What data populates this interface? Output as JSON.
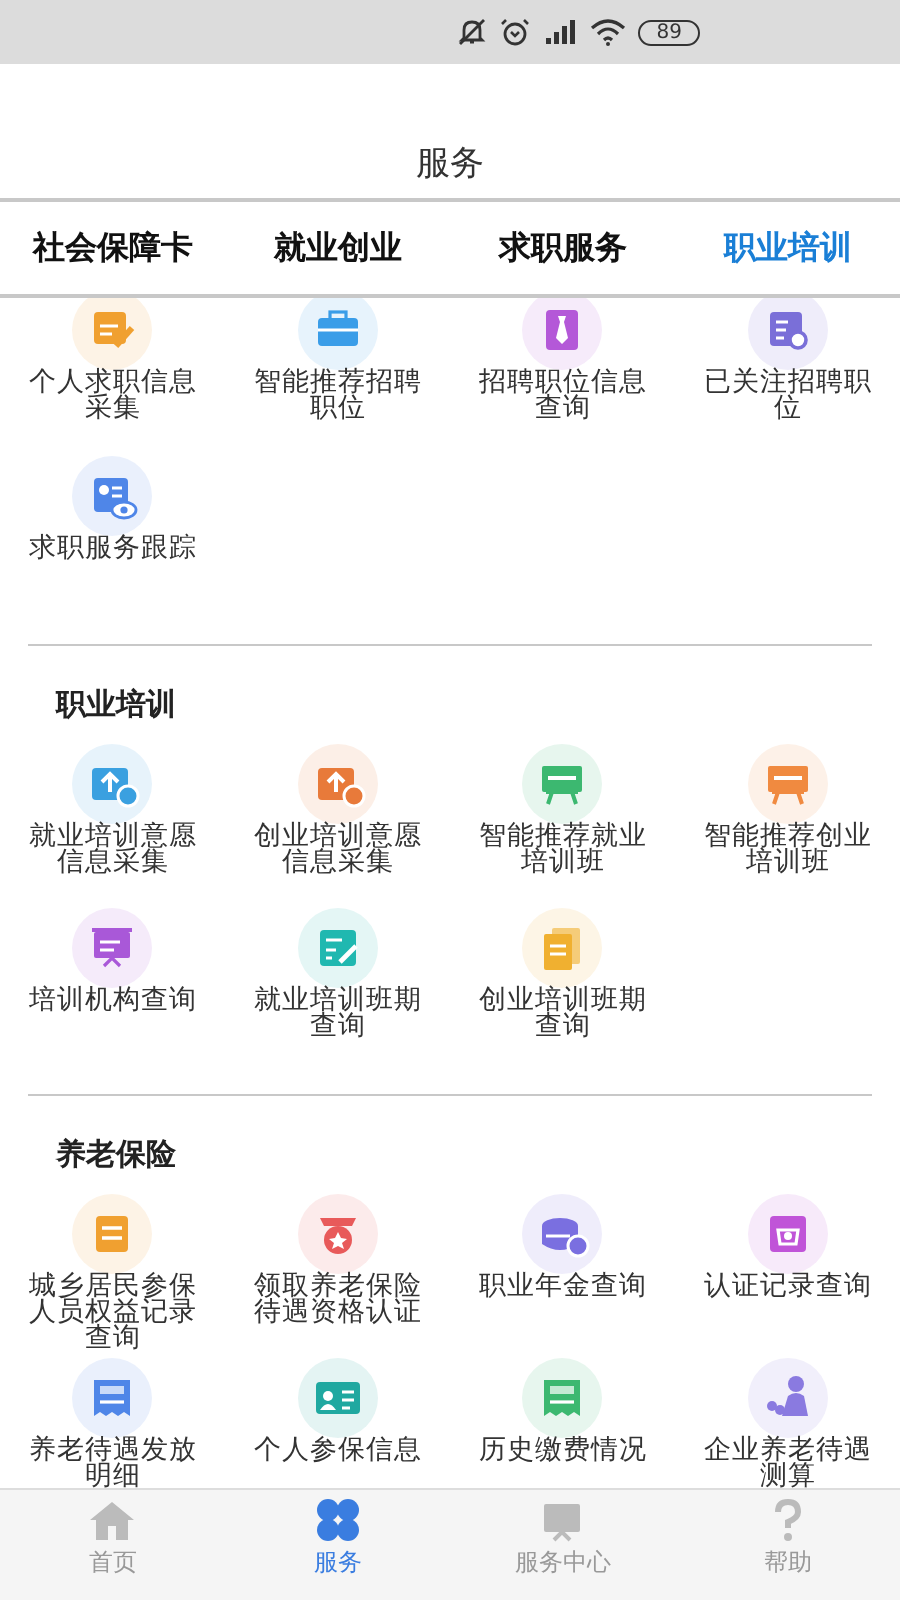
{
  "status_bar": {
    "battery": "89"
  },
  "header": {
    "title": "服务"
  },
  "tabs": [
    {
      "label": "社会保障卡",
      "selected": false
    },
    {
      "label": "就业创业",
      "selected": false
    },
    {
      "label": "求职服务",
      "selected": false
    },
    {
      "label": "职业培训",
      "selected": true
    }
  ],
  "sections": [
    {
      "items": [
        {
          "label": "个人求职信息采集",
          "kind": "docpen",
          "color": "#f0a030"
        },
        {
          "label": "智能推荐招聘职位",
          "kind": "briefcase",
          "color": "#3a9de8"
        },
        {
          "label": "招聘职位信息查询",
          "kind": "tie",
          "color": "#b458d8"
        },
        {
          "label": "已关注招聘职位",
          "kind": "search",
          "color": "#7a6fd8"
        },
        {
          "label": "求职服务跟踪",
          "kind": "eye",
          "color": "#4f86e8"
        }
      ]
    },
    {
      "title": "职业培训",
      "items": [
        {
          "label": "就业培训意愿信息采集",
          "kind": "upload",
          "color": "#3aa0e0"
        },
        {
          "label": "创业培训意愿信息采集",
          "kind": "upload",
          "color": "#e87a3a"
        },
        {
          "label": "智能推荐就业培训班",
          "kind": "easel",
          "color": "#3cb870"
        },
        {
          "label": "智能推荐创业培训班",
          "kind": "easel",
          "color": "#f08a40"
        },
        {
          "label": "培训机构查询",
          "kind": "screen",
          "color": "#a958d8"
        },
        {
          "label": "就业培训班期查询",
          "kind": "pencil",
          "color": "#20b8b0"
        },
        {
          "label": "创业培训班期查询",
          "kind": "book",
          "color": "#f0b030"
        }
      ]
    },
    {
      "title": "养老保险",
      "items": [
        {
          "label": "城乡居民参保人员权益记录查询",
          "kind": "doc",
          "color": "#f0a030"
        },
        {
          "label": "领取养老保险待遇资格认证",
          "kind": "medal",
          "color": "#e85a5a"
        },
        {
          "label": "职业年金查询",
          "kind": "coins",
          "color": "#7a6fe0"
        },
        {
          "label": "认证记录查询",
          "kind": "stamp",
          "color": "#c054d8"
        },
        {
          "label": "养老待遇发放明细",
          "kind": "receipt",
          "color": "#4f86e8"
        },
        {
          "label": "个人参保信息",
          "kind": "idcard",
          "color": "#20a8a0"
        },
        {
          "label": "历史缴费情况",
          "kind": "receipt",
          "color": "#3cb870"
        },
        {
          "label": "企业养老待遇测算",
          "kind": "people",
          "color": "#8a7ae0"
        }
      ]
    }
  ],
  "bottom_nav": [
    {
      "label": "首页",
      "kind": "home",
      "selected": false
    },
    {
      "label": "服务",
      "kind": "grid",
      "selected": true
    },
    {
      "label": "服务中心",
      "kind": "board",
      "selected": false
    },
    {
      "label": "帮助",
      "kind": "help",
      "selected": false
    }
  ]
}
